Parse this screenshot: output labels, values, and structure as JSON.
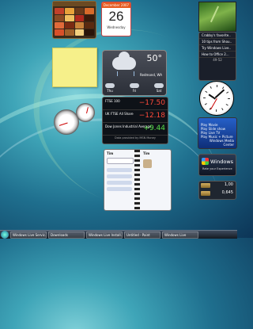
{
  "puzzle": {
    "title": "",
    "tiles": [
      "#c2402a",
      "#e8a23a",
      "#6b3a1a",
      "#d86a2a",
      "#8a4a22",
      "#f0c060",
      "#b0281e",
      "#3a1a0a",
      "#e06a3a",
      "#7a2a12",
      "#c8823a",
      "#5a2a10",
      "#d8502a",
      "#a0602a",
      "#f2d080",
      "#2a1408"
    ]
  },
  "calendar": {
    "month": "December 2007",
    "day": "26",
    "weekday": "Wednesday"
  },
  "feeds": {
    "items": [
      "Crabby's favorite..",
      "10 tips from Shou..",
      "Try Windows Live..",
      "How to Office 2..."
    ],
    "nav": "49-52"
  },
  "weather": {
    "temp": "50°",
    "sub": [
      "",
      ""
    ],
    "location": "Redmond, WA",
    "days": [
      "Thu",
      "Fri",
      "Sat"
    ]
  },
  "clock": {
    "hour": 10,
    "minute": 8,
    "second": 35
  },
  "stocks": {
    "rows": [
      {
        "name": "FTSE 100",
        "price": "",
        "change": "−17.50",
        "color": "#ff4a3a"
      },
      {
        "name": "UK FTSE All Share",
        "price": "",
        "change": "−12.18",
        "color": "#ff4a3a"
      },
      {
        "name": "Dow Jones Industrial Average",
        "price": "",
        "change": "+9.44",
        "color": "#58e04a"
      }
    ],
    "footer": "Data provided by MSN Money"
  },
  "cpu": {
    "cpu_level": 0.1,
    "mem_level": 0.55
  },
  "contacts": {
    "left_header": "Tim",
    "right_header": "Tim"
  },
  "media": {
    "lines": [
      "Play Movie",
      "Play Slide show",
      "Play Live TV",
      "Play Music + Picture"
    ],
    "brand": "Windows Media Center"
  },
  "badge": {
    "title": "Windows",
    "subtitle": "Rate your Experience"
  },
  "currency": {
    "rows": [
      "1,00",
      "0,645"
    ]
  },
  "taskbar": {
    "buttons": [
      "Windows Live Servic...",
      "Downloads",
      "Windows Live Install...",
      "Untitled - Paint",
      "Windows Live"
    ]
  }
}
